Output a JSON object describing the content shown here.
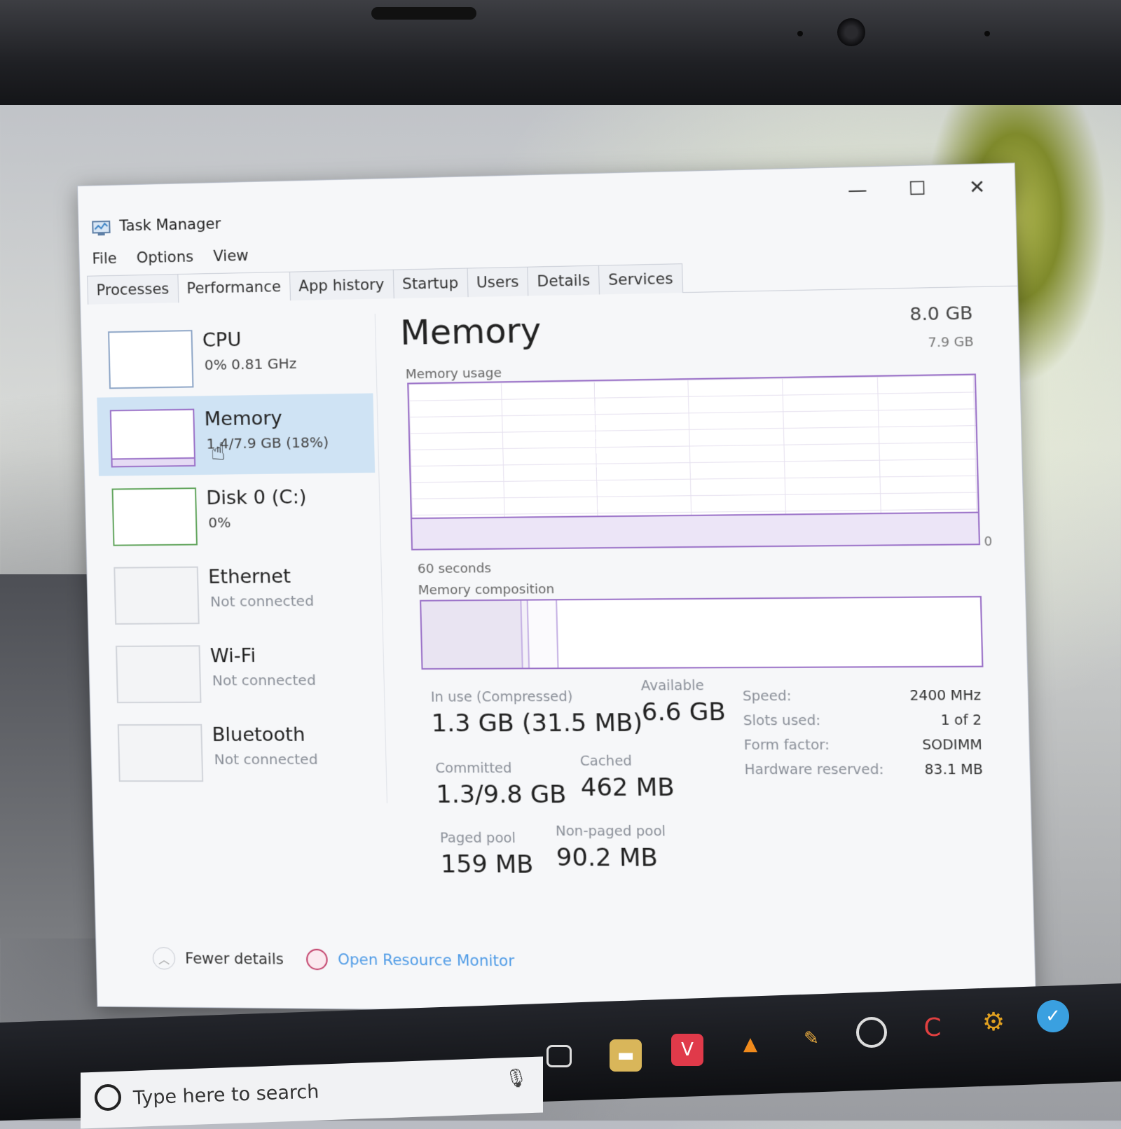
{
  "window": {
    "title": "Task Manager",
    "minimize_glyph": "—",
    "maximize_glyph": "☐",
    "close_glyph": "✕"
  },
  "menu": [
    "File",
    "Options",
    "View"
  ],
  "tabs": [
    "Processes",
    "Performance",
    "App history",
    "Startup",
    "Users",
    "Details",
    "Services"
  ],
  "active_tab": "Performance",
  "sidebar": {
    "items": [
      {
        "name": "CPU",
        "detail": "0% 0.81 GHz",
        "icon": "cpu-graph-thumbnail"
      },
      {
        "name": "Memory",
        "detail": "1.4/7.9 GB (18%)",
        "icon": "memory-graph-thumbnail",
        "selected": true
      },
      {
        "name": "Disk 0 (C:)",
        "detail": "0%",
        "icon": "disk-graph-thumbnail"
      },
      {
        "name": "Ethernet",
        "detail": "Not connected",
        "icon": "ethernet-graph-thumbnail"
      },
      {
        "name": "Wi-Fi",
        "detail": "Not connected",
        "icon": "wifi-graph-thumbnail"
      },
      {
        "name": "Bluetooth",
        "detail": "Not connected",
        "icon": "bluetooth-graph-thumbnail"
      }
    ]
  },
  "main": {
    "heading": "Memory",
    "total": "8.0 GB",
    "graph_max": "7.9 GB",
    "usage_label": "Memory usage",
    "graph_min": "0",
    "time_label": "60 seconds",
    "composition_label": "Memory composition",
    "usage_fraction": 0.18,
    "composition_fractions": {
      "in_use": 0.18,
      "modified": 0.01,
      "standby": 0.05
    },
    "stats": {
      "in_use_label": "In use (Compressed)",
      "in_use_value": "1.3 GB (31.5 MB)",
      "available_label": "Available",
      "available_value": "6.6 GB",
      "committed_label": "Committed",
      "committed_value": "1.3/9.8 GB",
      "cached_label": "Cached",
      "cached_value": "462 MB",
      "paged_label": "Paged pool",
      "paged_value": "159 MB",
      "nonpaged_label": "Non-paged pool",
      "nonpaged_value": "90.2 MB"
    },
    "specs": [
      {
        "key": "Speed:",
        "value": "2400 MHz"
      },
      {
        "key": "Slots used:",
        "value": "1 of 2"
      },
      {
        "key": "Form factor:",
        "value": "SODIMM"
      },
      {
        "key": "Hardware reserved:",
        "value": "83.1 MB"
      }
    ]
  },
  "footer": {
    "fewer_details": "Fewer details",
    "resource_monitor": "Open Resource Monitor"
  },
  "taskbar": {
    "search_placeholder": "Type here to search",
    "icons": [
      "task-view-icon",
      "file-explorer-icon",
      "vivaldi-icon",
      "vlc-icon",
      "pencil-icon",
      "spinner-app-icon",
      "ccleaner-icon",
      "gear-app-icon",
      "blue-app-icon"
    ]
  },
  "colors": {
    "memory_accent": "#9b72c8",
    "selected_bg": "#cfe3f4",
    "link": "#4f9be6"
  }
}
